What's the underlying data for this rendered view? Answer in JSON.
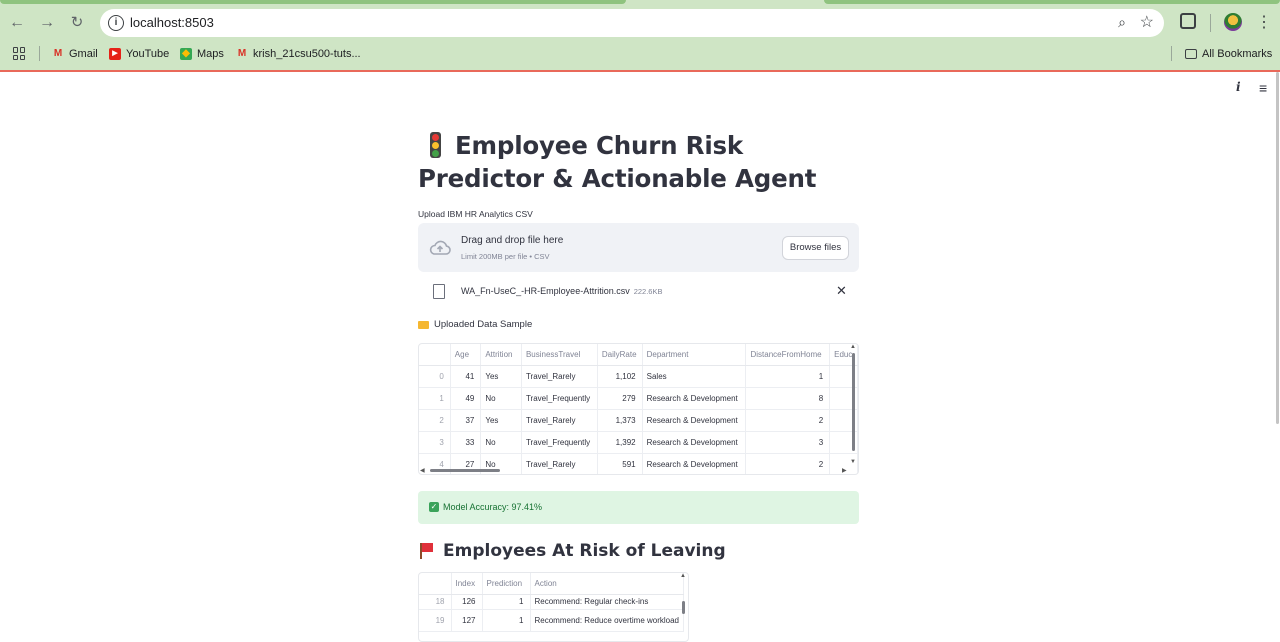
{
  "browser": {
    "url": "localhost:8503",
    "bookmarks": [
      {
        "label": "Gmail",
        "icon": "gmail-icon"
      },
      {
        "label": "YouTube",
        "icon": "youtube-icon"
      },
      {
        "label": "Maps",
        "icon": "maps-icon"
      },
      {
        "label": "krish_21csu500-tuts...",
        "icon": "gmail-icon"
      }
    ],
    "all_bookmarks": "All Bookmarks",
    "theme_color": "#cfe5c5"
  },
  "app": {
    "title": "Employee Churn Risk Predictor & Actionable Agent",
    "uploader": {
      "label": "Upload IBM HR Analytics CSV",
      "drag_text": "Drag and drop file here",
      "limit_text": "Limit 200MB per file • CSV",
      "browse_label": "Browse files"
    },
    "file": {
      "name": "WA_Fn-UseC_-HR-Employee-Attrition.csv",
      "size": "222.6KB"
    },
    "sample_section": "Uploaded Data Sample",
    "sample_table": {
      "columns": [
        "",
        "Age",
        "Attrition",
        "BusinessTravel",
        "DailyRate",
        "Department",
        "DistanceFromHome",
        "Educ"
      ],
      "rows": [
        [
          "0",
          "41",
          "Yes",
          "Travel_Rarely",
          "1,102",
          "Sales",
          "1"
        ],
        [
          "1",
          "49",
          "No",
          "Travel_Frequently",
          "279",
          "Research & Development",
          "8"
        ],
        [
          "2",
          "37",
          "Yes",
          "Travel_Rarely",
          "1,373",
          "Research & Development",
          "2"
        ],
        [
          "3",
          "33",
          "No",
          "Travel_Frequently",
          "1,392",
          "Research & Development",
          "3"
        ],
        [
          "4",
          "27",
          "No",
          "Travel_Rarely",
          "591",
          "Research & Development",
          "2"
        ]
      ]
    },
    "accuracy_text": "Model Accuracy: 97.41%",
    "risk_heading": "Employees At Risk of Leaving",
    "risk_table": {
      "columns": [
        "",
        "Index",
        "Prediction",
        "Action"
      ],
      "rows": [
        [
          "18",
          "126",
          "1",
          "Recommend: Regular check-ins"
        ],
        [
          "19",
          "127",
          "1",
          "Recommend: Reduce overtime workload"
        ]
      ]
    },
    "colors": {
      "success_bg": "#dff5e3",
      "success_text": "#177233",
      "accent": "#ff4b4b"
    }
  }
}
